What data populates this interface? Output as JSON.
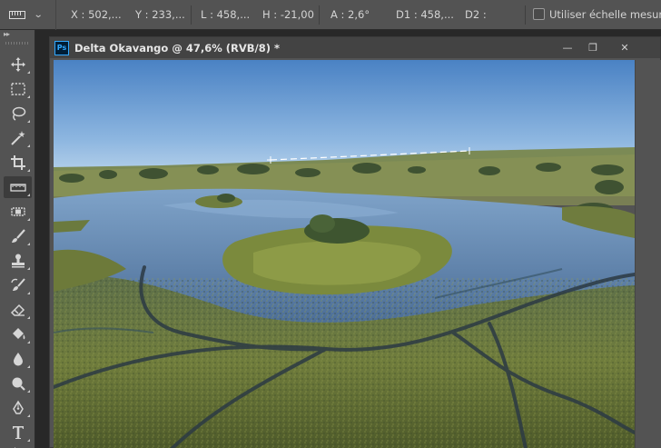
{
  "options_bar": {
    "tool_icon": "ruler-icon",
    "x_label": "X : 502,...",
    "y_label": "Y : 233,...",
    "l_label": "L : 458,...",
    "h_label": "H : -21,00",
    "a_label": "A : 2,6°",
    "d1_label": "D1 : 458,...",
    "d2_label": "D2 :",
    "scale_checkbox_label": "Utiliser échelle mesure",
    "scale_checked": false
  },
  "toolbar": {
    "collapse_glyph": "▸▸",
    "tools": [
      {
        "name": "move-tool",
        "icon": "move-icon"
      },
      {
        "name": "marquee-tool",
        "icon": "rect-marquee-icon"
      },
      {
        "name": "lasso-tool",
        "icon": "lasso-icon"
      },
      {
        "name": "quick-select-tool",
        "icon": "magic-wand-icon"
      },
      {
        "name": "crop-tool",
        "icon": "crop-icon"
      },
      {
        "name": "ruler-tool",
        "icon": "ruler-icon",
        "active": true
      },
      {
        "name": "healing-tool",
        "icon": "bandage-icon"
      },
      {
        "name": "brush-tool",
        "icon": "brush-icon"
      },
      {
        "name": "stamp-tool",
        "icon": "stamp-icon"
      },
      {
        "name": "history-brush-tool",
        "icon": "history-brush-icon"
      },
      {
        "name": "eraser-tool",
        "icon": "eraser-icon"
      },
      {
        "name": "paint-bucket-tool",
        "icon": "bucket-icon"
      },
      {
        "name": "blur-tool",
        "icon": "drop-icon"
      },
      {
        "name": "dodge-tool",
        "icon": "dodge-icon"
      },
      {
        "name": "pen-tool",
        "icon": "pen-icon"
      },
      {
        "name": "type-tool",
        "icon": "type-icon"
      },
      {
        "name": "path-select-tool",
        "icon": "arrow-icon"
      }
    ]
  },
  "document": {
    "app_badge": "Ps",
    "title": "Delta Okavango @ 47,6% (RVB/8) *",
    "minimize_glyph": "—",
    "restore_glyph": "❐",
    "close_glyph": "✕"
  },
  "colors": {
    "ui_dark": "#282828",
    "ui_panel": "#535353",
    "ui_title": "#434343",
    "ps_blue": "#31a8ff",
    "sky_top": "#4f86c6",
    "sky_bottom": "#a9c9e8",
    "water": "#5b82ad",
    "marsh_green": "#7c8a3e"
  }
}
